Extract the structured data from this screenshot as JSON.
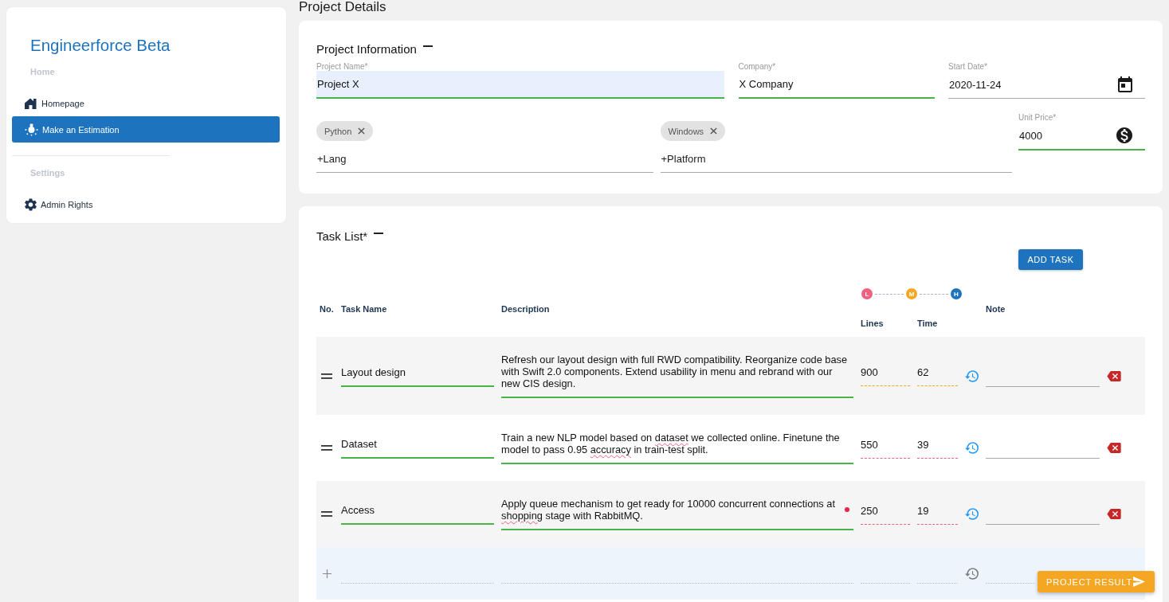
{
  "sidebar": {
    "brand": "Engineerforce Beta",
    "sections": [
      {
        "title": "Home",
        "items": [
          {
            "label": "Homepage",
            "kind": "home",
            "selected": false
          },
          {
            "label": "Make an Estimation",
            "kind": "estimate",
            "selected": true
          }
        ]
      },
      {
        "title": "Settings",
        "items": [
          {
            "label": "Admin Rights",
            "kind": "settings",
            "selected": false
          }
        ]
      }
    ]
  },
  "page_title": "Project Details",
  "project_information": {
    "title": "Project Information",
    "rows": [
      [
        {
          "kind": "text",
          "label": "Project Name*",
          "value": "Project X",
          "valid": true,
          "autofilled": true
        },
        {
          "kind": "text",
          "label": "Company*",
          "value": "X Company",
          "valid": true,
          "autofilled": false
        },
        {
          "kind": "date",
          "label": "Start Date*",
          "value": "2020-11-24",
          "valid": false,
          "autofilled": false
        }
      ],
      [
        {
          "kind": "tags",
          "tags": [
            "Python"
          ],
          "placeholder": "+Lang",
          "valid": false
        },
        {
          "kind": "tags",
          "tags": [
            "Windows"
          ],
          "placeholder": "+Platform",
          "valid": false
        },
        {
          "kind": "money",
          "label": "Unit Price*",
          "value": "4000",
          "valid": true,
          "autofilled": false
        }
      ]
    ]
  },
  "task_list": {
    "title": "Task List*",
    "add_button": "ADD TASK",
    "legend": [
      {
        "label": "L",
        "color": "#f2607f"
      },
      {
        "label": "M",
        "color": "#f5a623"
      },
      {
        "label": "H",
        "color": "#1e73be"
      }
    ],
    "columns": [
      "No.",
      "Task Name",
      "Description",
      "Lines",
      "Time",
      "Note"
    ],
    "rows": [
      {
        "name": "Layout design",
        "valid": true,
        "description": [
          {
            "text": "Refresh our layout design with full RWD compatibility. Reorganize code base with Swift 2.0 components. Extend usability in menu and rebrand with our new CIS design.",
            "misspelled": false
          }
        ],
        "flagged": false,
        "lines": "900",
        "time": "62",
        "color": "#f5a623"
      },
      {
        "name": "Dataset",
        "valid": true,
        "description": [
          {
            "text": "Train a new NLP model based on ",
            "misspelled": false
          },
          {
            "text": "dataset",
            "misspelled": true
          },
          {
            "text": " we collected online. Finetune the model to pass 0.95 ",
            "misspelled": false
          },
          {
            "text": "accuracy",
            "misspelled": true
          },
          {
            "text": " in train-test split.",
            "misspelled": false
          }
        ],
        "flagged": false,
        "lines": "550",
        "time": "39",
        "color": "#f2607f"
      },
      {
        "name": "Access",
        "valid": true,
        "description": [
          {
            "text": "Apply queue mechanism to get ready for 10000 concurrent connections at ",
            "misspelled": false
          },
          {
            "text": "shopping",
            "misspelled": true
          },
          {
            "text": " stage with RabbitMQ.",
            "misspelled": false
          }
        ],
        "flagged": true,
        "lines": "250",
        "time": "19",
        "color": "#f2607f"
      }
    ]
  },
  "result_button": "PROJECT RESULT"
}
